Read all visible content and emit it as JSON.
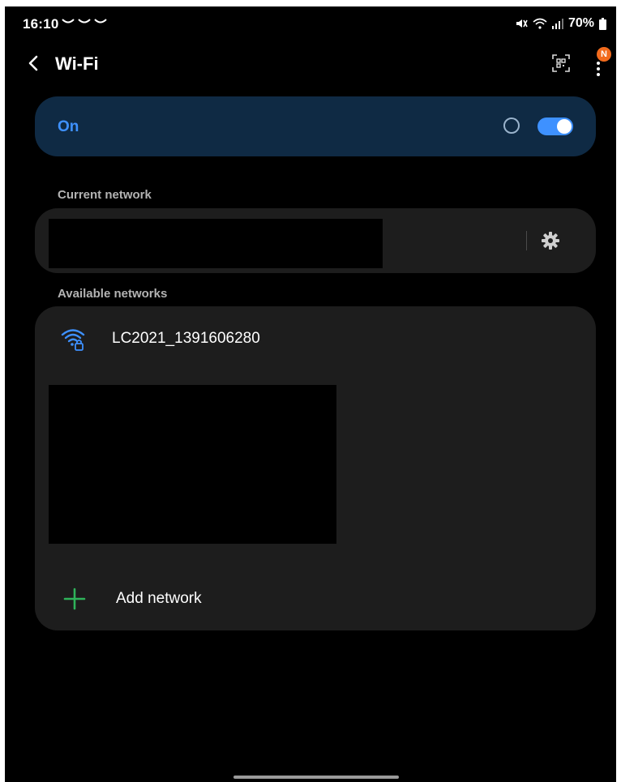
{
  "status": {
    "time": "16:10",
    "battery": "70%"
  },
  "header": {
    "title": "Wi-Fi",
    "badge": "N"
  },
  "wifi_toggle": {
    "label": "On",
    "enabled": true
  },
  "sections": {
    "current": "Current network",
    "available": "Available networks"
  },
  "available_networks": [
    {
      "name": "LC2021_1391606280",
      "secured": true
    }
  ],
  "add_network": {
    "label": "Add network"
  },
  "colors": {
    "accent": "#3e91ff",
    "on_card_bg": "#0f2a44",
    "card_bg": "#1d1d1d",
    "add_plus": "#2fb35a",
    "badge": "#f26b1d"
  }
}
